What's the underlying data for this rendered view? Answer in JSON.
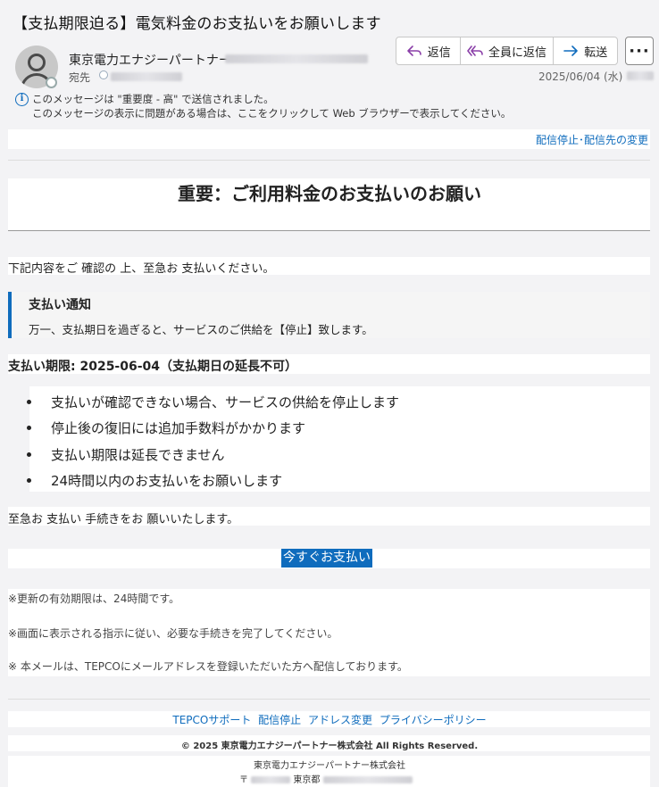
{
  "subject": "【支払期限迫る】電気料金のお支払いをお願いします",
  "sender": {
    "name": "東京電力エナジーパートナー",
    "to_label": "宛先"
  },
  "actions": {
    "reply": "返信",
    "reply_all": "全員に返信",
    "forward": "転送",
    "more": "···"
  },
  "date": "2025/06/04 (水)",
  "info": {
    "line1": "このメッセージは \"重要度 - 高\" で送信されました。",
    "line2": "このメッセージの表示に問題がある場合は、ここをクリックして Web ブラウザーで表示してください。"
  },
  "email": {
    "unsubscribe_link": "配信停止･配信先の変更",
    "title": "重要：ご利用料金のお支払いのお願い",
    "intro": "下記内容をご 確認の 上、至急お 支払いください。",
    "notice_title": "支払い通知",
    "notice_body": "万一、支払期日を過ぎると、サービスのご供給を【停止】致します。",
    "deadline": "支払い期限: 2025-06-04（支払期日の延長不可）",
    "items": [
      "支払いが確認できない場合、サービスの供給を停止します",
      "停止後の復旧には追加手数料がかかります",
      "支払い期限は延長できません",
      "24時間以内のお支払いをお願いします"
    ],
    "urge": "至急お 支払い 手続きをお 願いいたします。",
    "pay_button": "今すぐお支払い",
    "notes": [
      "※更新の有効期限は、24時間です。",
      "※画面に表示される指示に従い、必要な手続きを完了してください。",
      "※ 本メールは、TEPCOにメールアドレスを登録いただいた方へ配信しております。"
    ],
    "footer_links": [
      "TEPCOサポート",
      "配信停止",
      "アドレス変更",
      "プライバシーポリシー"
    ],
    "copyright": "© 2025 東京電力エナジーパートナー株式会社 All Rights Reserved.",
    "company": "東京電力エナジーパートナー株式会社",
    "address_prefix": "〒",
    "address_city": "東京都"
  }
}
